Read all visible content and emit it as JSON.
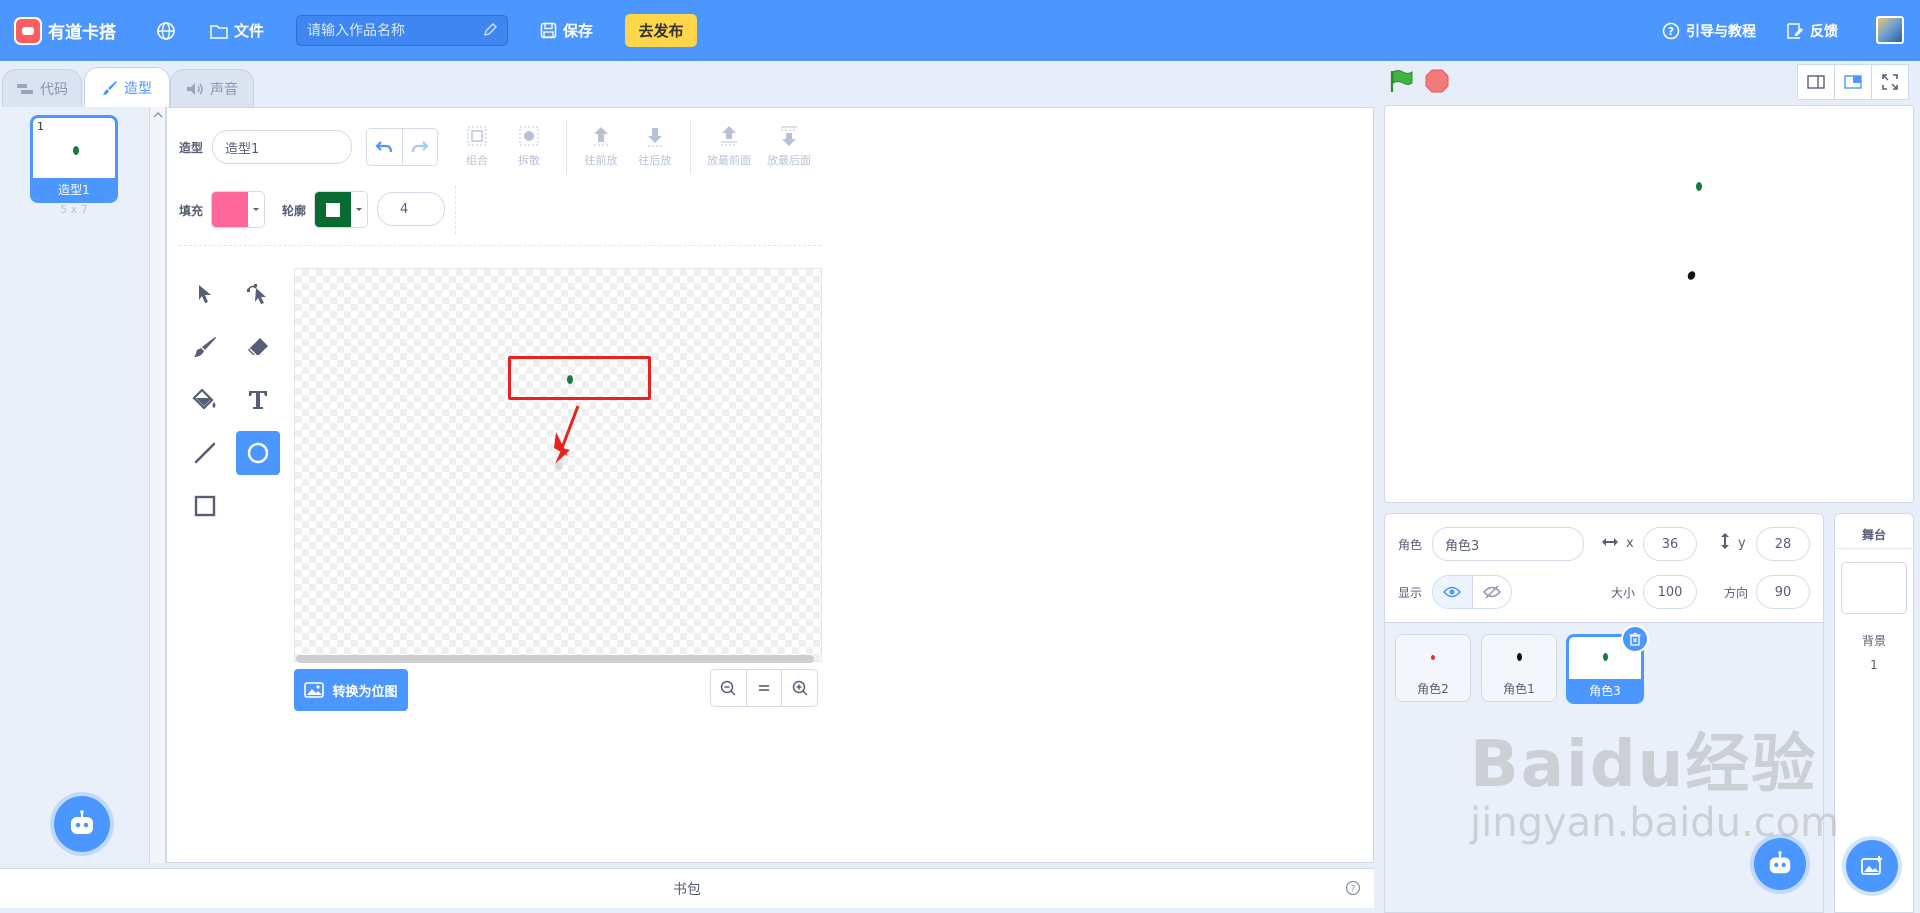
{
  "topbar": {
    "app_name": "有道卡搭",
    "file_label": "文件",
    "title_placeholder": "请输入作品名称",
    "save_label": "保存",
    "publish_label": "去发布",
    "guide_label": "引导与教程",
    "feedback_label": "反馈"
  },
  "tabs": [
    {
      "label": "代码",
      "active": false
    },
    {
      "label": "造型",
      "active": true
    },
    {
      "label": "声音",
      "active": false
    }
  ],
  "costume_list": {
    "items": [
      {
        "index": "1",
        "name": "造型1",
        "size": "5 x 7"
      }
    ]
  },
  "editor": {
    "costume_label": "造型",
    "costume_name": "造型1",
    "actions": {
      "group": "组合",
      "ungroup": "拆散",
      "forward": "往前放",
      "backward": "往后放",
      "front": "放最前面",
      "back": "放最后面"
    },
    "fill_label": "填充",
    "outline_label": "轮廓",
    "outline_width": "4",
    "fill_color": "#ff6699",
    "outline_color": "#0a6b30",
    "convert_bitmap_label": "转换为位图"
  },
  "backpack_label": "书包",
  "sprite_info": {
    "sprite_label": "角色",
    "sprite_name": "角色3",
    "x_label": "x",
    "x_value": "36",
    "y_label": "y",
    "y_value": "28",
    "show_label": "显示",
    "size_label": "大小",
    "size_value": "100",
    "direction_label": "方向",
    "direction_value": "90"
  },
  "sprites": [
    {
      "name": "角色2",
      "dot_color": "#e03030",
      "active": false
    },
    {
      "name": "角色1",
      "dot_color": "#111111",
      "active": false
    },
    {
      "name": "角色3",
      "dot_color": "#1a7a3c",
      "active": true
    }
  ],
  "stage_panel": {
    "title": "舞台",
    "backdrop_label": "背景",
    "backdrop_count": "1"
  },
  "watermark": {
    "line1": "Baidu经验",
    "line2": "jingyan.baidu.com"
  },
  "colors": {
    "accent": "#4c97ff",
    "publish": "#ffd54a",
    "highlight_box": "#e8231f"
  }
}
